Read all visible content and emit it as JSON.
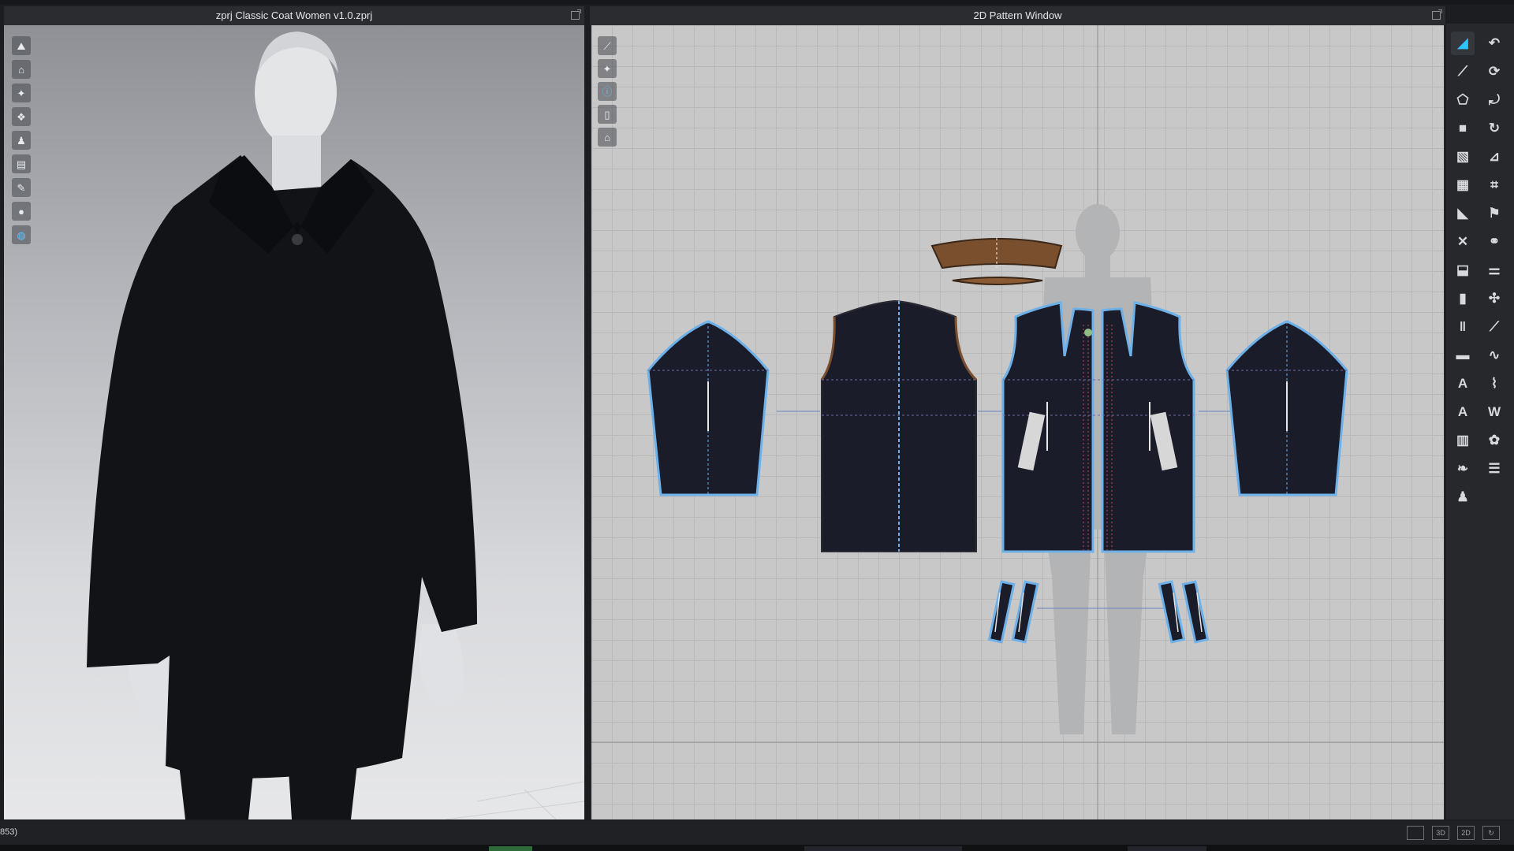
{
  "viewport3d": {
    "title": "zprj Classic Coat Women v1.0.zprj",
    "tools": [
      "avatar-display-icon",
      "garment-display-icon",
      "shirt-icon",
      "shirts-icon",
      "person-icon",
      "fabric-icon",
      "brush-icon",
      "avatar-silhouette-icon",
      "texture-sphere-icon"
    ]
  },
  "pattern2d": {
    "title": "2D Pattern Window",
    "tools": [
      "edit-pattern-icon",
      "shirt-view-icon",
      "info-icon",
      "sheet-icon",
      "lock-shirt-icon"
    ]
  },
  "right_toolbar": {
    "icons": [
      "transform-pattern-icon",
      "edit-curvature-icon",
      "edit-point-icon",
      "rotate-pattern-icon",
      "polygon-icon",
      "trace-icon",
      "rectangle-icon",
      "rotate-copy-icon",
      "internal-polygon-icon",
      "ruler-icon",
      "texture-region-icon",
      "stitch-icon",
      "dart-icon",
      "fold-icon",
      "cut-icon",
      "button-icon",
      "segment-icon",
      "zipper-icon",
      "board-icon",
      "elastic-icon",
      "seamline-icon",
      "topstitch-icon",
      "measure-icon",
      "puckering-icon",
      "annotation-a-icon",
      "wave-icon",
      "text-a-icon",
      "ww-text-icon",
      "grid-icon",
      "grading-icon",
      "fabric-tool-icon",
      "layers-icon",
      "pin-person-icon"
    ]
  },
  "statusbar": {
    "coords": "853)",
    "view_modes": [
      "",
      "3D",
      "2D",
      "↻"
    ]
  },
  "colors": {
    "accent": "#2ec4ff",
    "pattern_fill": "#1b1c2a",
    "outline": "#6eb0e8",
    "collar": "#7a4f2e"
  }
}
